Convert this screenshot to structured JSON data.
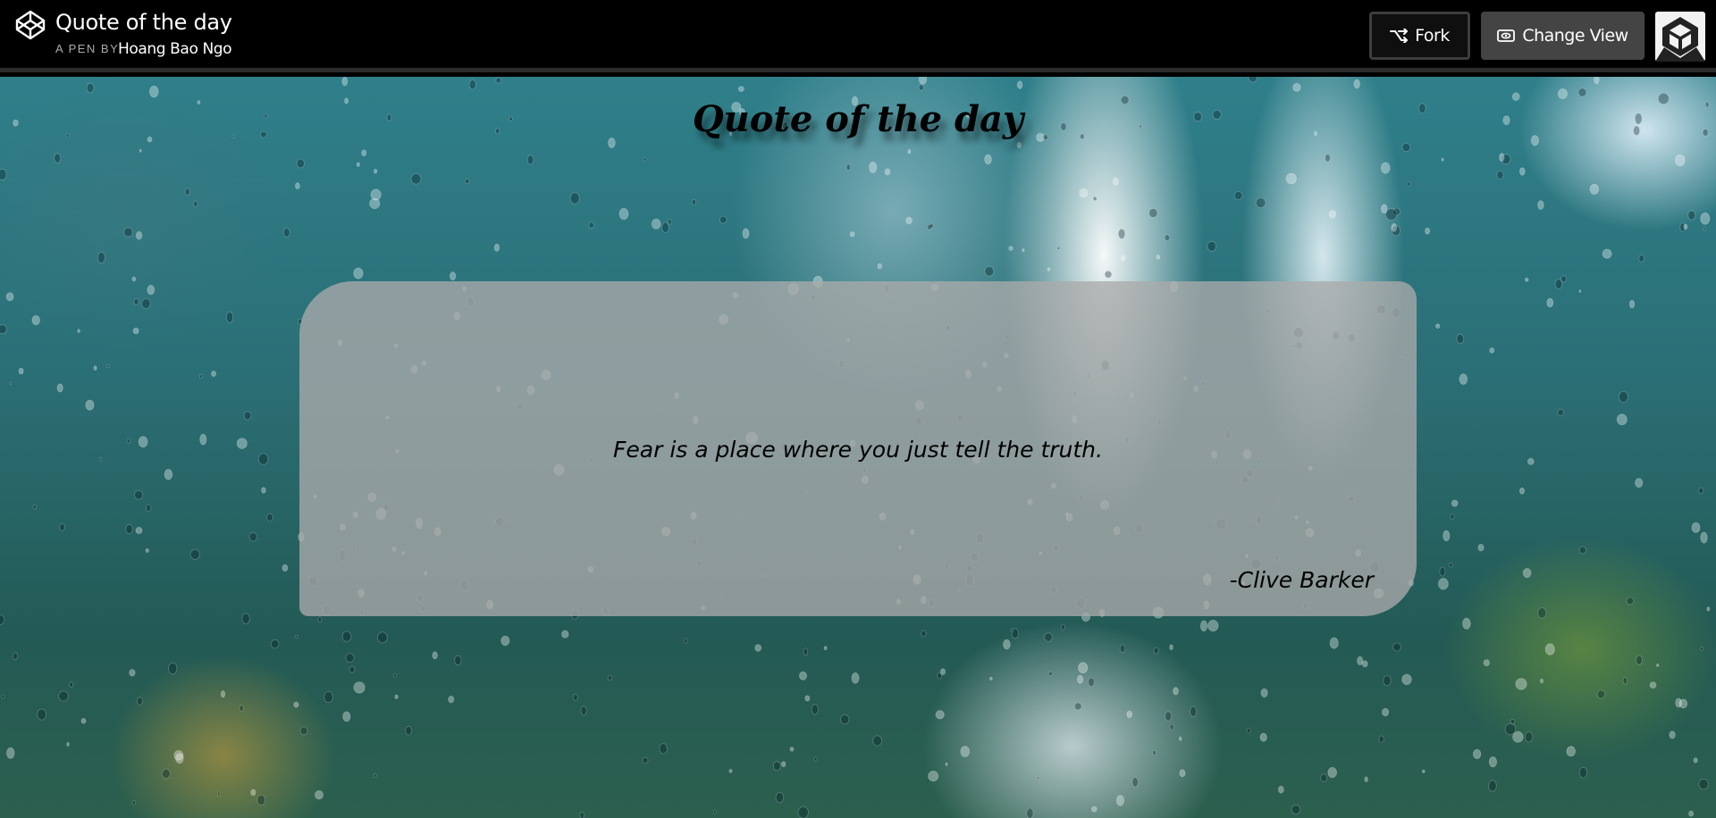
{
  "header": {
    "title": "Quote of the day",
    "by_prefix": "A PEN BY",
    "author": "Hoang Bao Ngo",
    "fork_label": "Fork",
    "change_view_label": "Change View"
  },
  "page": {
    "title": "Quote of the day",
    "quote": "Fear is a place where you just tell the truth.",
    "attribution": "-Clive Barker"
  },
  "icons": {
    "logo": "codepen-logo-icon",
    "fork": "fork-icon",
    "change_view": "eye-icon",
    "avatar": "user-avatar"
  }
}
